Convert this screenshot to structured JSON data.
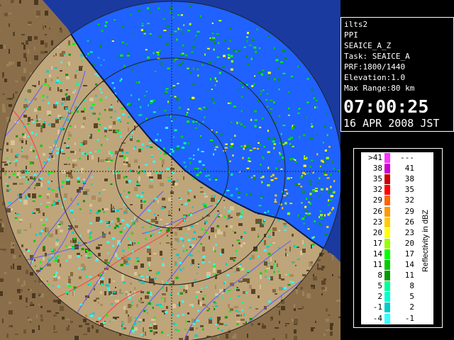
{
  "info": {
    "lines": [
      "ilts2",
      "PPI",
      "SEAICE_A_Z",
      "Task: SEAICE_A",
      "PRF:1800/1440",
      "Elevation:1.0",
      "Max Range:80 km"
    ],
    "time": "07:00:25",
    "date": "16 APR 2008 JST"
  },
  "legend": {
    "title": "Reflectivity in dBZ",
    "rows": [
      {
        "lo": ">41",
        "hi": "---",
        "color": "#ff33ff"
      },
      {
        "lo": "38",
        "hi": "41",
        "color": "#cc00cc"
      },
      {
        "lo": "35",
        "hi": "38",
        "color": "#cc0000"
      },
      {
        "lo": "32",
        "hi": "35",
        "color": "#ff0000"
      },
      {
        "lo": "29",
        "hi": "32",
        "color": "#ff6600"
      },
      {
        "lo": "26",
        "hi": "29",
        "color": "#ff9900"
      },
      {
        "lo": "23",
        "hi": "26",
        "color": "#ffcc00"
      },
      {
        "lo": "20",
        "hi": "23",
        "color": "#ffff00"
      },
      {
        "lo": "17",
        "hi": "20",
        "color": "#99ff00"
      },
      {
        "lo": "14",
        "hi": "17",
        "color": "#00ff00"
      },
      {
        "lo": "11",
        "hi": "14",
        "color": "#00cc00"
      },
      {
        "lo": "8",
        "hi": "11",
        "color": "#009900"
      },
      {
        "lo": "5",
        "hi": "8",
        "color": "#00ff99"
      },
      {
        "lo": "2",
        "hi": "5",
        "color": "#00ffcc"
      },
      {
        "lo": "-1",
        "hi": "2",
        "color": "#00cccc"
      },
      {
        "lo": "-4",
        "hi": "-1",
        "color": "#33ffff"
      }
    ]
  },
  "map": {
    "colors": {
      "background": "#000000",
      "sea_outside": "#1a3aa0",
      "sea_in_range": "#1f62ff",
      "land_outside": "#8a6e4a",
      "land_in_range": "#bfa57a",
      "coast": "#0a1a3a",
      "river": "#5a5aff",
      "border": "#ff3a3a",
      "grid": "#222222"
    },
    "rain_palette": [
      "#33ffff",
      "#00cccc",
      "#00ff99",
      "#009900",
      "#00cc00",
      "#00ff00",
      "#99ff00",
      "#ffff00",
      "#ffcc00"
    ]
  }
}
